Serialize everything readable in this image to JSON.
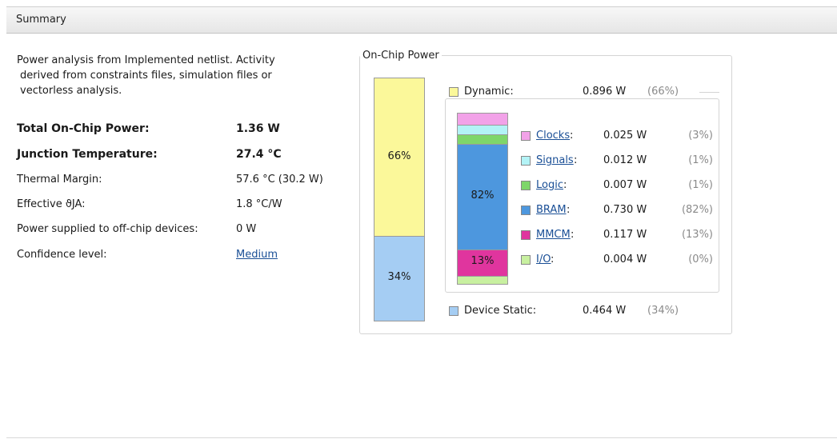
{
  "header": {
    "title": "Summary"
  },
  "description": {
    "line1": "Power analysis from Implemented netlist. Activity",
    "line2": "derived from constraints files, simulation files or",
    "line3": "vectorless analysis."
  },
  "metrics": [
    {
      "label": "Total On-Chip Power:",
      "value": "1.36 W",
      "bold": true
    },
    {
      "label": "Junction Temperature:",
      "value": "27.4 °C",
      "bold": true
    },
    {
      "label": "Thermal Margin:",
      "value": "57.6 °C (30.2 W)"
    },
    {
      "label": "Effective ϑJA:",
      "value": "1.8 °C/W"
    },
    {
      "label": "Power supplied to off-chip devices:",
      "value": "0 W"
    },
    {
      "label": "Confidence level:",
      "value": "Medium",
      "link": true
    }
  ],
  "on_chip": {
    "title": "On-Chip Power",
    "dynamic": {
      "label": "Dynamic:",
      "value": "0.896 W",
      "pct": "(66%)",
      "bar_pct": "66%",
      "color": "#fbf89a"
    },
    "static": {
      "label": "Device Static:",
      "value": "0.464 W",
      "pct": "(34%)",
      "bar_pct": "34%",
      "color": "#a5cdf3"
    },
    "items": [
      {
        "label": "Clocks",
        "value": "0.025 W",
        "pct": "(3%)",
        "color": "#f2a2e8"
      },
      {
        "label": "Signals",
        "value": "0.012 W",
        "pct": "(1%)",
        "color": "#b3f3f6"
      },
      {
        "label": "Logic",
        "value": "0.007 W",
        "pct": "(1%)",
        "color": "#7ed66a"
      },
      {
        "label": "BRAM",
        "value": "0.730 W",
        "pct": "(82%)",
        "color": "#4d97de"
      },
      {
        "label": "MMCM",
        "value": "0.117 W",
        "pct": "(13%)",
        "color": "#e0359e"
      },
      {
        "label": "I/O",
        "value": "0.004 W",
        "pct": "(0%)",
        "color": "#c8f0a0"
      }
    ],
    "bar_labels": {
      "bram": "82%",
      "mmcm": "13%"
    }
  }
}
